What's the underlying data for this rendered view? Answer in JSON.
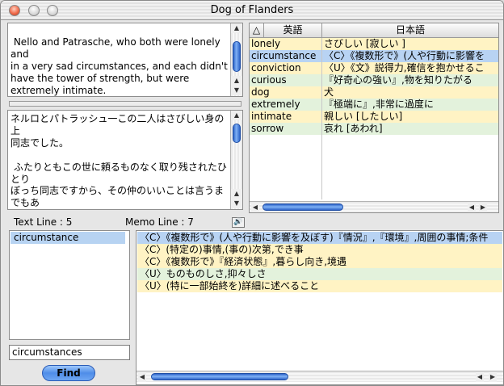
{
  "window": {
    "title": "Dog of Flanders"
  },
  "english_text": " Nello and Patrasche, who both were lonely and\nin a very sad circumstances, and each didn't\nhave the tower of strength, but were\nextremely intimate.\nThey were",
  "japanese_text": "ネルロとパトラッシュ一この二人はさびしい身の上\n同志でした。\n\n ふたりともこの世に頼るものなく取り残されたひとり\nぼっち同志ですから、その仲のいいことは言うまでもあ\nりません。いや、「仲がいい」くらいな言葉では言いあら\nわせません。兄弟でもこれほど愛し合っている者はま\nずないでしょう。ほんとにこれ以上の親しさはかんがえ",
  "word_table": {
    "sort_icon_glyph": "△",
    "headers": {
      "english": "英語",
      "japanese": "日本語"
    },
    "rows": [
      {
        "en": "lonely",
        "ja": "さびしい [寂しい ]",
        "bg": "#fff3c4"
      },
      {
        "en": "circumstance",
        "ja": "〈C〉《複数形で》(人や行動に影響を",
        "bg": "#b8d3f3"
      },
      {
        "en": "conviction",
        "ja": "〈U〉《文》説得力,確信を抱かせるこ",
        "bg": "#fff3c4"
      },
      {
        "en": "curious",
        "ja": "『好奇心の強い』,物を知りたがる",
        "bg": "#e3f2dc"
      },
      {
        "en": "dog",
        "ja": "犬",
        "bg": "#fff3c4"
      },
      {
        "en": "extremely",
        "ja": "『極端に』,非常に過度に",
        "bg": "#e3f2dc"
      },
      {
        "en": "intimate",
        "ja": "親しい [したしい]",
        "bg": "#fff3c4"
      },
      {
        "en": "sorrow",
        "ja": "哀れ [あわれ]",
        "bg": "#e3f2dc"
      }
    ]
  },
  "status": {
    "text_line_label": "Text Line : 5",
    "memo_line_label": "Memo Line : 7"
  },
  "word_list": {
    "items": [
      "circumstance"
    ]
  },
  "search": {
    "value": "circumstances"
  },
  "find_button": {
    "label": "Find"
  },
  "definitions": [
    {
      "text": "〈C〉《複数形で》(人や行動に影響を及ぼす)『情況』,『環境』,周囲の事情;条件",
      "bg": "#b8d3f3"
    },
    {
      "text": "〈C〉(特定の)事情,(事の)次第,でき事",
      "bg": "#fff3c4"
    },
    {
      "text": "〈C〉《複数形で》『経済状態』,暮らし向き,境遇",
      "bg": "#fff3c4"
    },
    {
      "text": "〈U〉ものものしさ,抑々しさ",
      "bg": "#e3f2dc"
    },
    {
      "text": "〈U〉(特に一部始終を)詳細に述べること",
      "bg": "#fff3c4"
    }
  ],
  "icons": {
    "speaker": "speaker-icon",
    "sort": "sort-triangle-icon"
  },
  "colors": {
    "selection": "#b7d3f2",
    "scroll_accent": "#3b74d8"
  }
}
